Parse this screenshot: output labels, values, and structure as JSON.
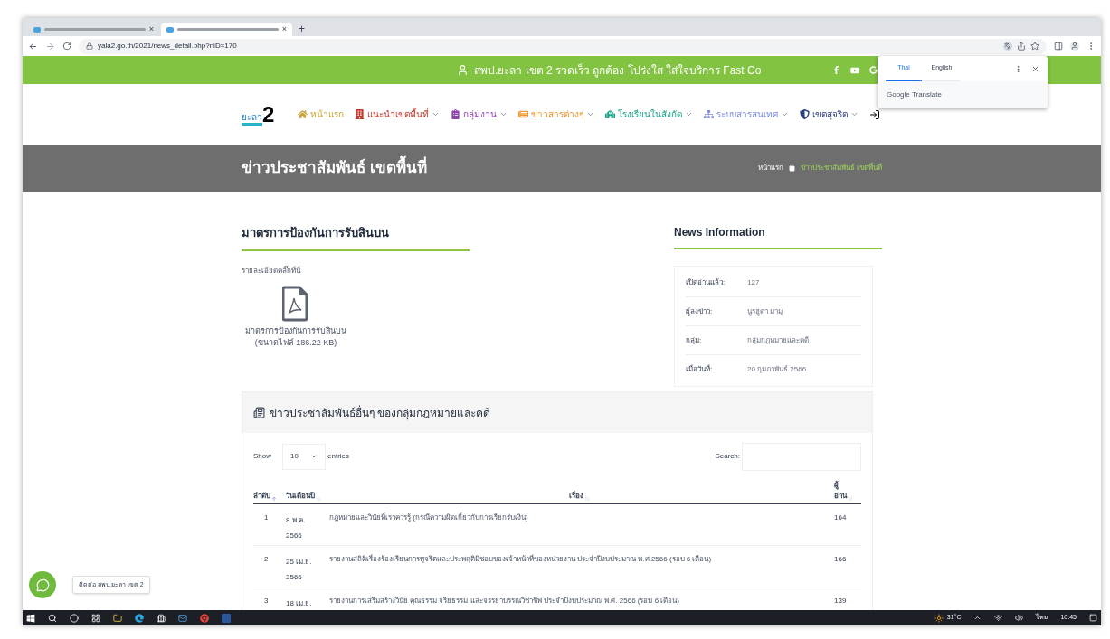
{
  "browser": {
    "tabs": [
      {
        "selected": false,
        "close": "×"
      },
      {
        "selected": true,
        "close": "×"
      }
    ],
    "new_tab": "+",
    "url": "yala2.go.th/2021/news_detail.php?niD=170"
  },
  "topbar": {
    "slogan": "สพป.ยะลา เขต 2  รวดเร็ว ถูกต้อง โปร่งใส ใส่ใจบริการ Fast Co"
  },
  "translate_popup": {
    "tabs": [
      {
        "label": "Thai",
        "selected": true
      },
      {
        "label": "English",
        "selected": false
      }
    ],
    "footer": "Google Translate"
  },
  "logo": {
    "text": "ยะลา",
    "number": "2"
  },
  "nav": [
    {
      "kind": "home",
      "label": "หน้าแรก",
      "color": "#c8a23a",
      "dropdown": false
    },
    {
      "kind": "building",
      "label": "แนะนำเขตพื้นที่",
      "color": "#c0392b",
      "dropdown": true
    },
    {
      "kind": "list",
      "label": "กลุ่มงาน",
      "color": "#8e44ad",
      "dropdown": true
    },
    {
      "kind": "news",
      "label": "ข่าวสารต่างๆ",
      "color": "#f0932b",
      "dropdown": true
    },
    {
      "kind": "school",
      "label": "โรงเรียนในสังกัด",
      "color": "#16a085",
      "dropdown": true
    },
    {
      "kind": "system",
      "label": "ระบบสารสนเทศ",
      "color": "#7b8ce0",
      "dropdown": true
    },
    {
      "kind": "shield",
      "label": "เขตสุจริต",
      "color": "#2c3e80",
      "dropdown": true
    }
  ],
  "page_header": {
    "title": "ข่าวประชาสัมพันธ์ เขตพื้นที่",
    "breadcrumb": [
      "หน้าแรก",
      "ข่าวประชาสัมพันธ์ เขตพื้นที่"
    ]
  },
  "article": {
    "title": "มาตรการป้องกันการรับสินบน",
    "intro": "รายละเอียดคลิ๊กที่นี่",
    "file_name": "มาตรการป้องกันการรับสินบน",
    "file_size": "(ขนาดไฟล์ 186.22 KB)"
  },
  "news_info": {
    "title": "News Information",
    "rows": [
      {
        "label": "เปิดอ่านแล้ว:",
        "value": "127"
      },
      {
        "label": "ผู้ลงข่าว:",
        "value": "นูรฮูดา มามุ"
      },
      {
        "label": "กลุ่ม:",
        "value": "กลุ่มกฎหมายและคดี"
      },
      {
        "label": "เมื่อวันที่:",
        "value": "20 กุมภาพันธ์ 2566"
      }
    ]
  },
  "related": {
    "title": "ข่าวประชาสัมพันธ์อื่นๆ ของกลุ่มกฎหมายและคดี",
    "show_label": "Show",
    "page_size": "10",
    "entries_label": "entries",
    "search_label": "Search:",
    "columns": [
      {
        "label": "ลำดับ",
        "sorted": true
      },
      {
        "label": "วันเดือนปี",
        "sorted": false
      },
      {
        "label": "เรื่อง",
        "sorted": false
      },
      {
        "label": "ผู้อ่าน",
        "sorted": false
      }
    ],
    "rows": [
      {
        "no": "1",
        "date": "8 พ.ค. 2566",
        "title": "กฎหมายและวินัยที่เราควรรู้ (กรณีความผิดเกี่ยวกับการเรียกรับเงิน)",
        "reads": "164"
      },
      {
        "no": "2",
        "date": "25 เม.ย. 2566",
        "title": "รายงานสถิติเรื่องร้องเรียนการทุจริตและประพฤติมิชอบของเจ้าหน้าที่ของหน่วยงาน ประจำปีงบประมาณ พ.ศ.2566 (รอบ 6 เดือน)",
        "reads": "166"
      },
      {
        "no": "3",
        "date": "18 เม.ย.",
        "title": "รายงานการเสริมสร้างวินัย คุณธรรม จริยธรรม และจรรยาบรรณวิชาชีพ ประจำปีงบประมาณ พ.ศ. 2566 (รอบ 6 เดือน)",
        "reads": "139"
      }
    ]
  },
  "chat": {
    "label": "ติดต่อ สพป.ยะลา เขต 2"
  },
  "taskbar": {
    "weather": "31°C",
    "language": "ไทย",
    "time": "10:45"
  }
}
